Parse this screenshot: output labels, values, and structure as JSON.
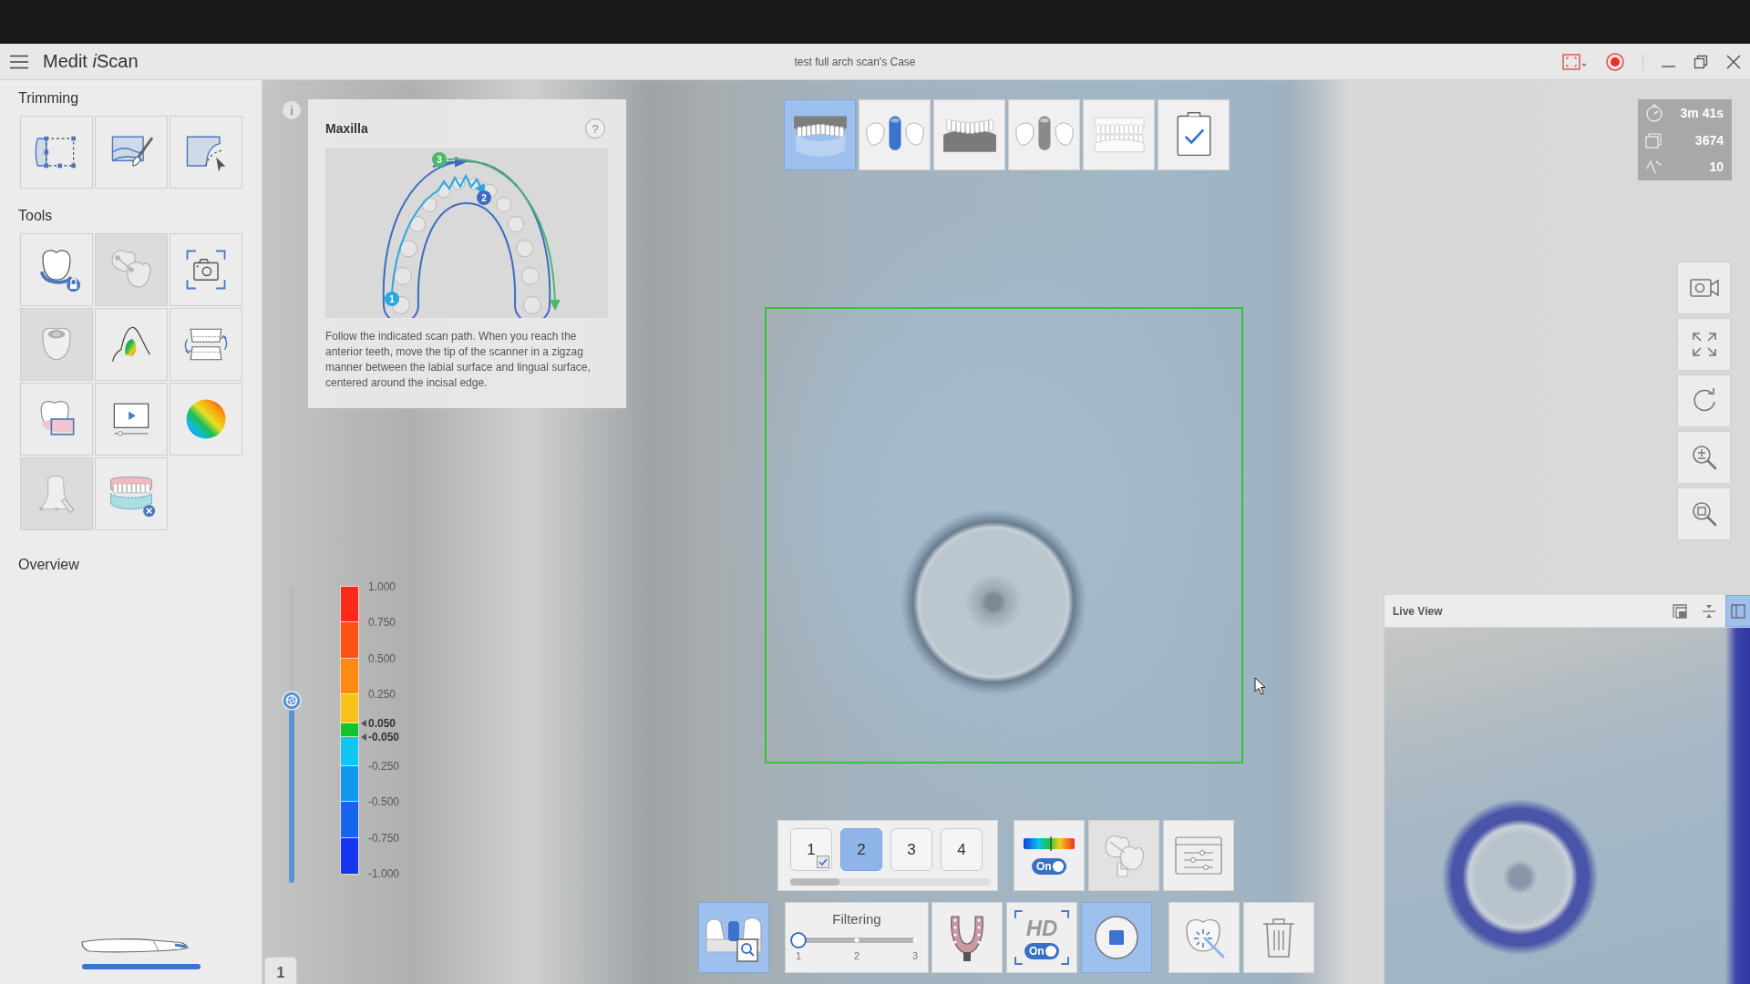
{
  "window": {
    "app_name": {
      "brand": "Medit",
      "product_mark": "i",
      "product": "Scan"
    },
    "title": "test full arch scan's Case"
  },
  "sidebar": {
    "sections": [
      {
        "title": "Trimming",
        "tools": [
          {
            "kind": "boxselect",
            "disabled": false
          },
          {
            "kind": "brush",
            "disabled": false
          },
          {
            "kind": "lasso",
            "disabled": false
          }
        ]
      },
      {
        "title": "Tools",
        "tools": [
          {
            "kind": "lockmargin",
            "disabled": false
          },
          {
            "kind": "linkteeth",
            "disabled": true
          },
          {
            "kind": "capture",
            "disabled": false
          },
          {
            "kind": "cavity",
            "disabled": true
          },
          {
            "kind": "undercut",
            "disabled": false
          },
          {
            "kind": "occlusion",
            "disabled": false
          },
          {
            "kind": "overlay",
            "disabled": false
          },
          {
            "kind": "replay",
            "disabled": false
          },
          {
            "kind": "colormap",
            "disabled": false
          },
          {
            "kind": "pen",
            "disabled": true
          },
          {
            "kind": "archdelete",
            "disabled": false
          }
        ]
      }
    ],
    "overview": {
      "title": "Overview"
    }
  },
  "viewport": {
    "info": "i",
    "page_tab": "1"
  },
  "guide": {
    "title": "Maxilla",
    "help": "?",
    "steps": [
      {
        "number": "1",
        "color": "#29a8e0"
      },
      {
        "number": "2",
        "color": "#3f6cc0"
      },
      {
        "number": "3",
        "color": "#4cb86a"
      }
    ],
    "description": "Follow the indicated scan path. When you reach the anterior teeth, move the tip of the scanner in a zigzag manner between the labial surface and lingual surface, centered around the incisal edge."
  },
  "scan_stages": [
    {
      "kind": "upper",
      "selected": true
    },
    {
      "kind": "upperbody",
      "selected": false
    },
    {
      "kind": "lower",
      "selected": false
    },
    {
      "kind": "lowerbody",
      "selected": false
    },
    {
      "kind": "occlusion",
      "selected": false
    },
    {
      "kind": "review",
      "selected": false
    }
  ],
  "stats": [
    {
      "kind": "time",
      "value": "3m 41s"
    },
    {
      "kind": "frames",
      "value": "3674"
    },
    {
      "kind": "angle",
      "value": "10"
    }
  ],
  "legend": {
    "segments": [
      {
        "color": "#ff2a1a"
      },
      {
        "color": "#ff5214"
      },
      {
        "color": "#ff8a12"
      },
      {
        "color": "#f7c21a"
      },
      {
        "color": "#10c42e"
      },
      {
        "color": "#12c6f2"
      },
      {
        "color": "#1298ee"
      },
      {
        "color": "#1466ee"
      },
      {
        "color": "#1436ee"
      }
    ],
    "ticks": [
      {
        "label": "1.000",
        "threshold": false
      },
      {
        "label": "0.750",
        "threshold": false
      },
      {
        "label": "0.500",
        "threshold": false
      },
      {
        "label": "0.250",
        "threshold": false
      },
      {
        "label": "0.050",
        "threshold": true
      },
      {
        "label": "-0.050",
        "threshold": true
      },
      {
        "label": "-0.250",
        "threshold": false
      },
      {
        "label": "-0.500",
        "threshold": false
      },
      {
        "label": "-0.750",
        "threshold": false
      },
      {
        "label": "-1.000",
        "threshold": false
      }
    ],
    "slider": {
      "level": 0.6
    }
  },
  "live_view": {
    "title": "Live View",
    "modes": [
      {
        "kind": "pip",
        "selected": false
      },
      {
        "kind": "split",
        "selected": false
      },
      {
        "kind": "dock",
        "selected": true
      }
    ]
  },
  "toolbar": {
    "stages": [
      {
        "label": "1",
        "selected": false,
        "checked": true
      },
      {
        "label": "2",
        "selected": true,
        "checked": false
      },
      {
        "label": "3",
        "selected": false,
        "checked": false
      },
      {
        "label": "4",
        "selected": false,
        "checked": false
      }
    ],
    "color_map": {
      "toggle": "On",
      "on": true
    },
    "align_tool": {
      "disabled": true
    },
    "tools": [
      {
        "kind": "library",
        "active": true
      },
      {
        "kind": "filtering",
        "title": "Filtering",
        "ticks": [
          "1",
          "2",
          "3"
        ],
        "level": 0
      },
      {
        "kind": "arch",
        "active": false
      },
      {
        "kind": "hd",
        "label": "HD",
        "toggle": "On",
        "on": true
      },
      {
        "kind": "stop",
        "active": true
      },
      {
        "kind": "ai",
        "active": false
      },
      {
        "kind": "delete",
        "active": false
      }
    ]
  }
}
